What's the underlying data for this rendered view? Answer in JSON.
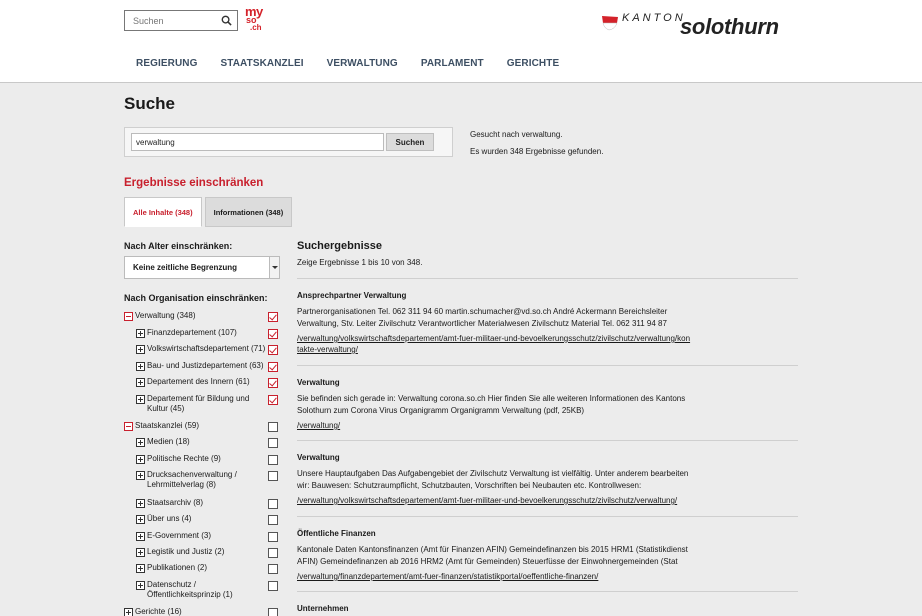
{
  "header": {
    "search_placeholder": "Suchen",
    "myso_logo": {
      "line1": "my",
      "line2": "so",
      "line3": ".ch"
    },
    "logo": {
      "kanton": "KANTON",
      "name": "solothurn"
    },
    "nav": [
      "REGIERUNG",
      "STAATSKANZLEI",
      "VERWALTUNG",
      "PARLAMENT",
      "GERICHTE"
    ]
  },
  "page_title": "Suche",
  "search": {
    "value": "verwaltung",
    "button": "Suchen",
    "info_line1": "Gesucht nach verwaltung.",
    "info_line2": "Es wurden 348 Ergebnisse gefunden."
  },
  "restrict_heading": "Ergebnisse einschränken",
  "tabs": [
    {
      "label": "Alle Inhalte (348)",
      "active": true
    },
    {
      "label": "Informationen (348)",
      "active": false
    }
  ],
  "filters": {
    "age_heading": "Nach Alter einschränken:",
    "age_select": "Keine zeitliche Begrenzung",
    "org_heading": "Nach Organisation einschränken:",
    "tree": [
      {
        "label": "Verwaltung (348)",
        "toggle": "minus",
        "level": 0,
        "checked": true
      },
      {
        "label": "Finanzdepartement (107)",
        "toggle": "plus",
        "level": 1,
        "checked": true
      },
      {
        "label": "Volkswirtschaftsdepartement (71)",
        "toggle": "plus",
        "level": 1,
        "checked": true
      },
      {
        "label": "Bau- und Justizdepartement (63)",
        "toggle": "plus",
        "level": 1,
        "checked": true
      },
      {
        "label": "Departement des Innern (61)",
        "toggle": "plus",
        "level": 1,
        "checked": true
      },
      {
        "label": "Departement für Bildung und",
        "label2": "Kultur (45)",
        "toggle": "plus",
        "level": 1,
        "checked": true
      },
      {
        "label": "Staatskanzlei (59)",
        "toggle": "minus",
        "level": 0,
        "checked": false
      },
      {
        "label": "Medien (18)",
        "toggle": "plus",
        "level": 1,
        "checked": false
      },
      {
        "label": "Politische Rechte (9)",
        "toggle": "plus",
        "level": 1,
        "checked": false
      },
      {
        "label": "Drucksachenverwaltung /",
        "label2": "Lehrmittelverlag (8)",
        "toggle": "plus",
        "level": 1,
        "checked": false
      },
      {
        "label": "Staatsarchiv (8)",
        "toggle": "plus",
        "level": 1,
        "checked": false
      },
      {
        "label": "Über uns (4)",
        "toggle": "plus",
        "level": 1,
        "checked": false
      },
      {
        "label": "E-Government (3)",
        "toggle": "plus",
        "level": 1,
        "checked": false
      },
      {
        "label": "Legistik und Justiz (2)",
        "toggle": "plus",
        "level": 1,
        "checked": false
      },
      {
        "label": "Publikationen (2)",
        "toggle": "plus",
        "level": 1,
        "checked": false
      },
      {
        "label": "Datenschutz /",
        "label2": "Öffentlichkeitsprinzip (1)",
        "toggle": "plus",
        "level": 1,
        "checked": false
      },
      {
        "label": "Gerichte (16)",
        "toggle": "plus",
        "level": 0,
        "checked": false
      }
    ]
  },
  "results": {
    "heading": "Suchergebnisse",
    "count": "Zeige Ergebnisse 1 bis 10 von 348.",
    "items": [
      {
        "title": "Ansprechpartner Verwaltung",
        "text1": "Partnerorganisationen Tel. 062 311 94 60 martin.schumacher@vd.so.ch   André Ackermann Bereichsleiter",
        "text2": "Verwaltung, Stv. Leiter Zivilschutz Verantwortlicher Materialwesen Zivilschutz Material Tel. 062 311 94 87",
        "link1": "/verwaltung/volkswirtschaftsdepartement/amt-fuer-militaer-und-bevoelkerungsschutz/zivilschutz/verwaltung/kon",
        "link2": "takte-verwaltung/"
      },
      {
        "title": "Verwaltung",
        "text1": "Sie befinden sich gerade in: Verwaltung corona.so.ch Hier finden Sie alle weiteren Informationen des Kantons",
        "text2": "Solothurn zum Corona Virus Organigramm Organigramm Verwaltung (pdf, 25KB)",
        "link1": "/verwaltung/",
        "link2": ""
      },
      {
        "title": "Verwaltung",
        "text1": "Unsere Hauptaufgaben Das Aufgabengebiet der Zivilschutz Verwaltung ist vielfältig. Unter anderem bearbeiten",
        "text2": "wir: Bauwesen: Schutzraumpflicht, Schutzbauten, Vorschriften bei Neubauten etc. Kontrollwesen:",
        "link1": "/verwaltung/volkswirtschaftsdepartement/amt-fuer-militaer-und-bevoelkerungsschutz/zivilschutz/verwaltung/",
        "link2": ""
      },
      {
        "title": "Öffentliche Finanzen",
        "text1": "Kantonale Daten Kantonsfinanzen (Amt für Finanzen AFIN) Gemeindefinanzen bis 2015 HRM1 (Statistikdienst",
        "text2": "AFIN) Gemeindefinanzen ab 2016 HRM2 (Amt für Gemeinden) Steuerfüsse der Einwohnergemeinden (Stat",
        "link1": "/verwaltung/finanzdepartement/amt-fuer-finanzen/statistikportal/oeffentliche-finanzen/",
        "link2": ""
      },
      {
        "title": "Unternehmen",
        "text1": "",
        "text2": "",
        "link1": "",
        "link2": ""
      }
    ]
  },
  "colors": {
    "accent": "#c8202d",
    "nav": "#3d4f63",
    "background": "#ececec"
  }
}
